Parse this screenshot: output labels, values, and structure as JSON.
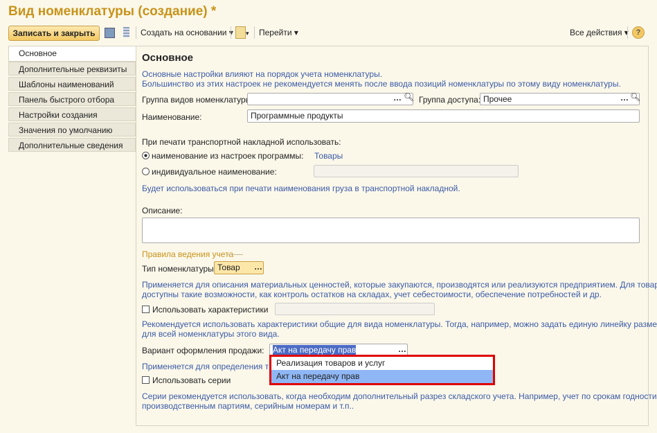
{
  "title": "Вид номенклатуры (создание) *",
  "toolbar": {
    "save_close": "Записать и закрыть",
    "create_based": "Создать на основании",
    "goto": "Перейти",
    "all_actions": "Все действия",
    "help": "?"
  },
  "tabs": [
    "Основное",
    "Дополнительные реквизиты",
    "Шаблоны наименований",
    "Панель быстрого отбора",
    "Настройки создания",
    "Значения по умолчанию",
    "Дополнительные сведения"
  ],
  "main": {
    "heading": "Основное",
    "info1": "Основные настройки влияют на порядок учета номенклатуры.",
    "info2": "Большинство из этих настроек не рекомендуется менять после ввода позиций номенклатуры по этому виду номенклатуры.",
    "group_label": "Группа видов номенклатуры:",
    "group_value": "",
    "access_label": "Группа доступа:",
    "access_value": "Прочее",
    "name_label": "Наименование:",
    "name_value": "Программные продукты",
    "print_label": "При печати транспортной накладной использовать:",
    "radio1": "наименование из настроек программы:",
    "radio1_link": "Товары",
    "radio2": "индивидуальное наименование:",
    "print_hint": "Будет использоваться при печати наименования груза в транспортной накладной.",
    "desc_label": "Описание:",
    "desc_value": "",
    "rules_title": "Правила ведения учета",
    "type_label": "Тип номенклатуры:",
    "type_value": "Товар",
    "type_hint1": "Применяется для описания материальных ценностей, которые закупаются, производятся или реализуются предприятием. Для товаров",
    "type_hint2": "доступны такие возможности, как контроль остатков на складах, учет себестоимости, обеспечение потребностей и др.",
    "chars_label": "Использовать характеристики",
    "chars_hint1": "Рекомендуется использовать характеристики общие для вида номенклатуры. Тогда, например, можно задать единую линейку размеров",
    "chars_hint2": "для всей номенклатуры этого вида.",
    "sale_label": "Вариант оформления продажи:",
    "sale_value": "Акт на передачу прав",
    "sale_hint": "Применяется для определения типа",
    "series_label": "Использовать серии",
    "series_hint1": "Серии рекомендуется использовать, когда необходим дополнительный разрез складского учета. Например, учет по срокам годности,",
    "series_hint2": "производственным партиям, серийным номерам и т.п..",
    "dropdown": [
      "Реализация товаров и услуг",
      "Акт на передачу прав"
    ]
  },
  "colors": {
    "highlight": "#e00000",
    "selected": "#8fb7f5"
  }
}
